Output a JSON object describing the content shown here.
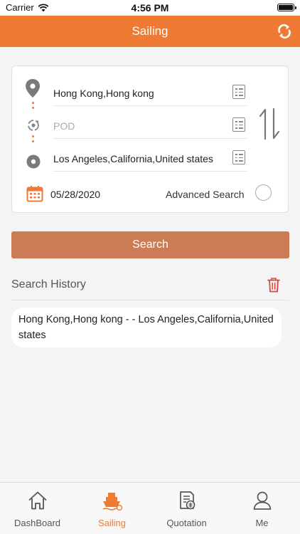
{
  "status_bar": {
    "carrier": "Carrier",
    "time": "4:56 PM"
  },
  "header": {
    "title": "Sailing",
    "action_icon": "refresh-swap-icon"
  },
  "form": {
    "origin": {
      "value": "Hong Kong,Hong kong",
      "icon": "location-pin-icon"
    },
    "pod": {
      "placeholder": "POD",
      "icon": "transit-point-icon"
    },
    "destination": {
      "value": "Los Angeles,California,United states",
      "icon": "destination-icon"
    },
    "date": "05/28/2020",
    "advanced_search_label": "Advanced Search",
    "advanced_search_checked": false
  },
  "search_button_label": "Search",
  "history": {
    "title": "Search History",
    "items": [
      {
        "text": "Hong Kong,Hong kong - - Los Angeles,California,United states"
      }
    ]
  },
  "tabs": [
    {
      "label": "DashBoard",
      "icon": "home-icon",
      "active": false
    },
    {
      "label": "Sailing",
      "icon": "ship-icon",
      "active": true
    },
    {
      "label": "Quotation",
      "icon": "quotation-icon",
      "active": false
    },
    {
      "label": "Me",
      "icon": "person-icon",
      "active": false
    }
  ],
  "colors": {
    "brand": "#ee7a33",
    "button": "#cc7c55",
    "trash": "#d9473b"
  }
}
